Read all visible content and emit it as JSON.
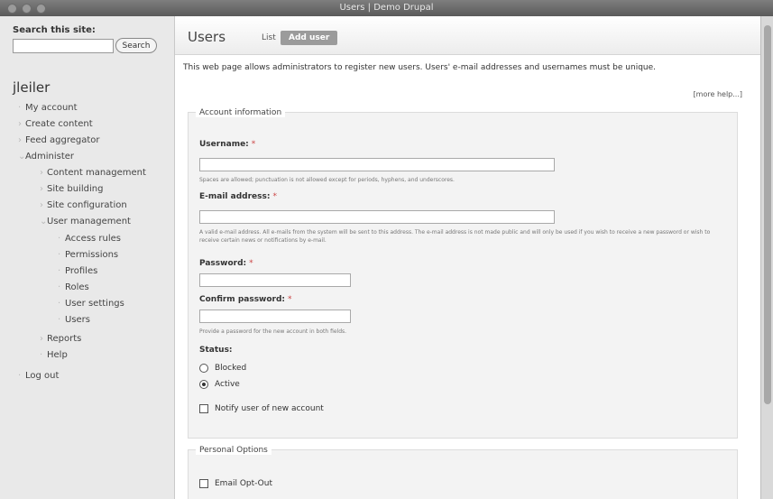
{
  "window": {
    "title": "Users | Demo Drupal"
  },
  "sidebar": {
    "search_label": "Search this site:",
    "search_value": "",
    "search_button": "Search",
    "user": "jleiler",
    "nav": [
      {
        "label": "My account"
      },
      {
        "label": "Create content"
      },
      {
        "label": "Feed aggregator"
      },
      {
        "label": "Administer"
      },
      {
        "label": "Content management"
      },
      {
        "label": "Site building"
      },
      {
        "label": "Site configuration"
      },
      {
        "label": "User management"
      },
      {
        "label": "Access rules"
      },
      {
        "label": "Permissions"
      },
      {
        "label": "Profiles"
      },
      {
        "label": "Roles"
      },
      {
        "label": "User settings"
      },
      {
        "label": "Users"
      },
      {
        "label": "Reports"
      },
      {
        "label": "Help"
      },
      {
        "label": "Log out"
      }
    ]
  },
  "main": {
    "title": "Users",
    "tabs": [
      {
        "label": "List"
      },
      {
        "label": "Add user"
      }
    ],
    "intro": "This web page allows administrators to register new users. Users' e-mail addresses and usernames must be unique.",
    "more_help": "[more help...]",
    "account_info": {
      "legend": "Account information",
      "username_label": "Username:",
      "username_value": "",
      "username_desc": "Spaces are allowed; punctuation is not allowed except for periods, hyphens, and underscores.",
      "email_label": "E-mail address:",
      "email_value": "",
      "email_desc": "A valid e-mail address. All e-mails from the system will be sent to this address. The e-mail address is not made public and will only be used if you wish to receive a new password or wish to receive certain news or notifications by e-mail.",
      "password_label": "Password:",
      "confirm_label": "Confirm password:",
      "password_desc": "Provide a password for the new account in both fields.",
      "status_label": "Status:",
      "status_blocked": "Blocked",
      "status_active": "Active",
      "notify_label": "Notify user of new account",
      "required_mark": "*"
    },
    "personal": {
      "legend": "Personal Options",
      "email_optout": "Email Opt-Out"
    }
  }
}
